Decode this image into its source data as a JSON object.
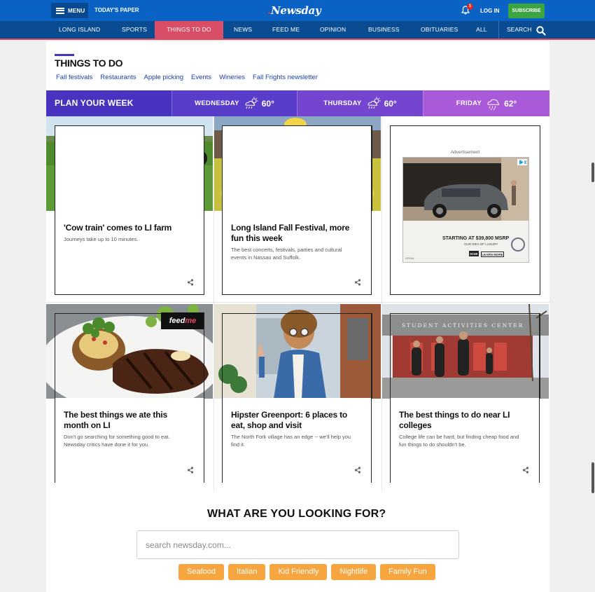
{
  "header": {
    "menu_label": "MENU",
    "todays_paper": "TODAY'S PAPER",
    "logo": "Newsday",
    "notification_count": "1",
    "login": "LOG IN",
    "subscribe": "SUBSCRIBE"
  },
  "nav": {
    "items": [
      "LONG ISLAND",
      "SPORTS",
      "THINGS TO DO",
      "NEWS",
      "FEED ME",
      "OPINION",
      "BUSINESS",
      "OBITUARIES",
      "ALL"
    ],
    "active": "THINGS TO DO",
    "search": "SEARCH"
  },
  "section": {
    "title": "THINGS TO DO",
    "links": [
      "Fall festivals",
      "Restaurants",
      "Apple picking",
      "Events",
      "Wineries",
      "Fall Frights newsletter"
    ]
  },
  "weather": {
    "plan_label": "PLAN YOUR WEEK",
    "days": [
      {
        "name": "WEDNESDAY",
        "temp": "60°",
        "icon": "rain-cloud-sun-icon"
      },
      {
        "name": "THURSDAY",
        "temp": "60°",
        "icon": "rain-cloud-sun-icon"
      },
      {
        "name": "FRIDAY",
        "temp": "62°",
        "icon": "rain-cloud-icon"
      }
    ]
  },
  "cards": [
    {
      "title_lines": [
        "'Cow train' comes to LI farm"
      ],
      "description_lines": [
        "Journeys take up to 10 minutes."
      ]
    },
    {
      "title_lines": [
        "Long Island Fall Festival, more",
        "fun this week"
      ],
      "description_lines": [
        "The best concerts, festivals, parties and cultural",
        "events in Nassau and Suffolk."
      ]
    },
    {
      "title_lines": [
        "The best things we ate this",
        "month on LI"
      ],
      "description_lines": [
        "Don't go searching for something good to eat.",
        "Newsday critics have done it for you."
      ]
    },
    {
      "title_lines": [
        "Hipster Greenport: 6 places to",
        "eat, shop and visit"
      ],
      "description_lines": [
        "The North Fork village has an edge -- we'll help you",
        "find it."
      ]
    },
    {
      "title_lines": [
        "The best things to do near LI",
        "colleges"
      ],
      "description_lines": [
        "College life can be hard, but finding cheap food and",
        "fun things to do shouldn't be."
      ]
    }
  ],
  "feedme_badge": {
    "feed": "feed",
    "me": "me"
  },
  "image_sign": "STUDENT ACTIVITIES CENTER",
  "advertisement": {
    "label": "Advertisement",
    "price": "STARTING AT $39,800 MSRP",
    "tagline": "OUR IDEA OF LUXURY",
    "model": "XC60",
    "cta": "LEARN MORE",
    "legal": "LEGAL"
  },
  "search": {
    "heading": "WHAT ARE YOU LOOKING FOR?",
    "placeholder": "search newsday.com...",
    "tags": [
      "Seafood",
      "Italian",
      "Kid Friendly",
      "Nightlife",
      "Family Fun"
    ]
  }
}
